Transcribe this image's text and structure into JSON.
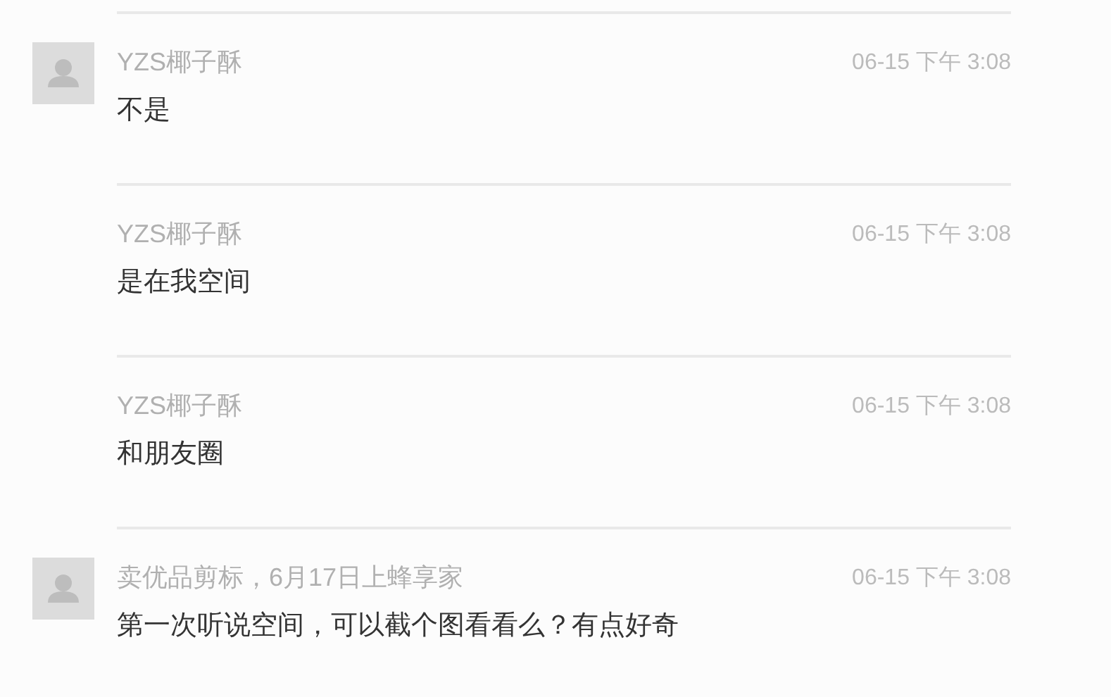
{
  "messages": [
    {
      "avatar": true,
      "name": "YZS椰子酥",
      "time": "06-15 下午 3:08",
      "text": "不是"
    },
    {
      "avatar": false,
      "name": "YZS椰子酥",
      "time": "06-15 下午 3:08",
      "text": "是在我空间"
    },
    {
      "avatar": false,
      "name": "YZS椰子酥",
      "time": "06-15 下午 3:08",
      "text": "和朋友圈"
    },
    {
      "avatar": true,
      "name": "卖优品剪标，6月17日上蜂享家",
      "time": "06-15 下午 3:08",
      "text": "第一次听说空间，可以截个图看看么？有点好奇"
    }
  ]
}
